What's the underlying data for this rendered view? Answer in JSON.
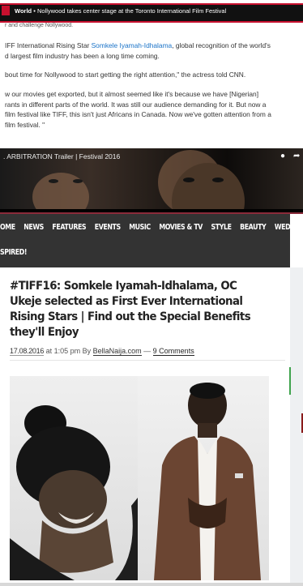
{
  "cnn": {
    "breadcrumb_section": "World",
    "breadcrumb_sep": "•",
    "breadcrumb_title": "Nollywood takes center stage at the Toronto International Film Festival",
    "cutoff_line": "r and challenge Nollywood.",
    "para1_pre": "IFF International Rising Star ",
    "para1_link": "Somkele Iyamah-Idhalama",
    "para1_post": ", global recognition of the world's",
    "para1_line2": "d largest film industry has been a long time coming.",
    "para2": "bout time for Nollywood to start getting the right attention,\" the actress told CNN.",
    "para3_line1": "w our movies get exported, but it almost seemed like it's because we have [Nigerian]",
    "para3_line2": "rants in different parts of the world. It was still our audience demanding for it. But now a",
    "para3_line3": "film festival like TIFF, this isn't just Africans in Canada. Now we've gotten attention from a",
    "para3_line4": "film festival. \"",
    "video_title": ". ARBITRATION Trailer | Festival 2016"
  },
  "bn": {
    "nav": [
      "OME",
      "NEWS",
      "FEATURES",
      "EVENTS",
      "MUSIC",
      "MOVIES & TV",
      "STYLE",
      "BEAUTY",
      "WEDDING"
    ],
    "nav_row2": "SPIRED!",
    "headline": "#TIFF16: Somkele Iyamah-Idhalama, OC Ukeje selected as First Ever International Rising Stars | Find out the Special Benefits they'll Enjoy",
    "date": "17.08.2016",
    "time": "at 1:05 pm By",
    "author": "BellaNaija.com",
    "dash": "—",
    "comments": "9 Comments"
  },
  "colors": {
    "cnn_red": "#c8102e",
    "nav_bg": "#333333",
    "link_blue": "#1a73c8"
  }
}
